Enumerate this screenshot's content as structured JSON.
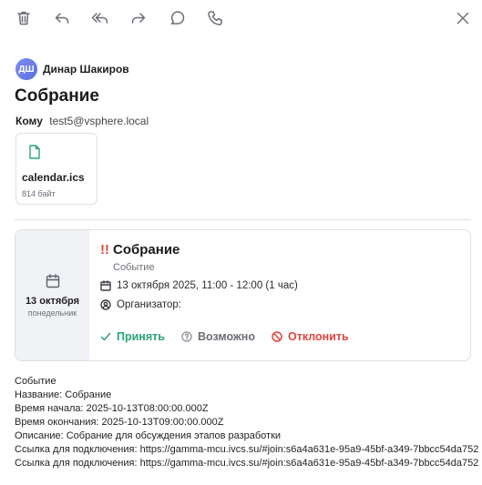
{
  "toolbar": {
    "icons": [
      "trash-icon",
      "reply-icon",
      "reply-all-icon",
      "forward-icon",
      "chat-icon",
      "phone-icon",
      "close-icon"
    ]
  },
  "sender": {
    "initials": "ДШ",
    "name": "Динар Шакиров"
  },
  "subject": "Собрание",
  "recipients": {
    "label": "Кому",
    "value": "test5@vsphere.local"
  },
  "attachment": {
    "name": "calendar.ics",
    "size": "814 байт"
  },
  "invite": {
    "date": "13 октября",
    "weekday": "понедельник",
    "priority_mark": "!!",
    "title": "Собрание",
    "type": "Событие",
    "time": "13 октября 2025, 11:00 - 12:00 (1 час)",
    "organizer_label": "Организатор:",
    "accept_label": "Принять",
    "maybe_label": "Возможно",
    "decline_label": "Отклонить"
  },
  "body": {
    "lines": [
      "Событие",
      "Название: Собрание",
      "Время начала: 2025-10-13T08:00:00.000Z",
      "Время окончания: 2025-10-13T09:00:00.000Z",
      "Описание: Собрание для обсуждения этапов разработки",
      "Ссылка для подключения: https://gamma-mcu.ivcs.su/#join:s6a4a631e-95a9-45bf-a349-7bbcc54da752",
      "Ссылка для подключения: https://gamma-mcu.ivcs.su/#join:s6a4a631e-95a9-45bf-a349-7bbcc54da752"
    ]
  },
  "colors": {
    "accent_green": "#2aa37a",
    "decline_red": "#e2453c",
    "avatar_blue": "#6b7de8"
  }
}
